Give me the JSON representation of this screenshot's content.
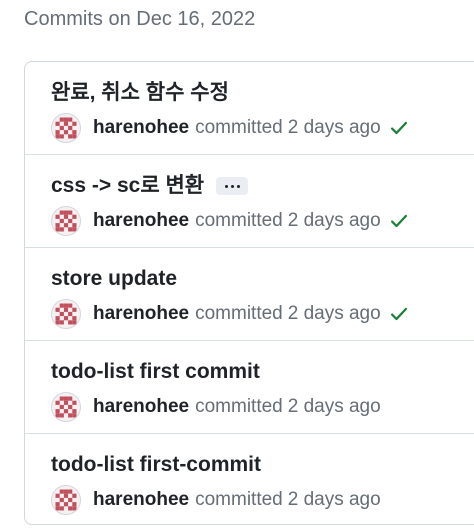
{
  "group": {
    "title": "Commits on Dec 16, 2022"
  },
  "commits": [
    {
      "title": "완료, 취소 함수 수정",
      "author": "harenohee",
      "action": "committed",
      "time": "2 days ago",
      "status_icon": "check-icon",
      "status_color": "#1a7f37",
      "has_ellipsis": false
    },
    {
      "title": "css -> sc로 변환",
      "author": "harenohee",
      "action": "committed",
      "time": "2 days ago",
      "status_icon": "check-icon",
      "status_color": "#1a7f37",
      "has_ellipsis": true
    },
    {
      "title": "store update",
      "author": "harenohee",
      "action": "committed",
      "time": "2 days ago",
      "status_icon": "check-icon",
      "status_color": "#1a7f37",
      "has_ellipsis": false
    },
    {
      "title": "todo-list first commit",
      "author": "harenohee",
      "action": "committed",
      "time": "2 days ago",
      "status_icon": null,
      "has_ellipsis": false
    },
    {
      "title": "todo-list first-commit",
      "author": "harenohee",
      "action": "committed",
      "time": "2 days ago",
      "status_icon": null,
      "has_ellipsis": false
    }
  ],
  "colors": {
    "avatar_identicon": "#c0505e",
    "muted_text": "#656d76",
    "success": "#1a7f37"
  }
}
